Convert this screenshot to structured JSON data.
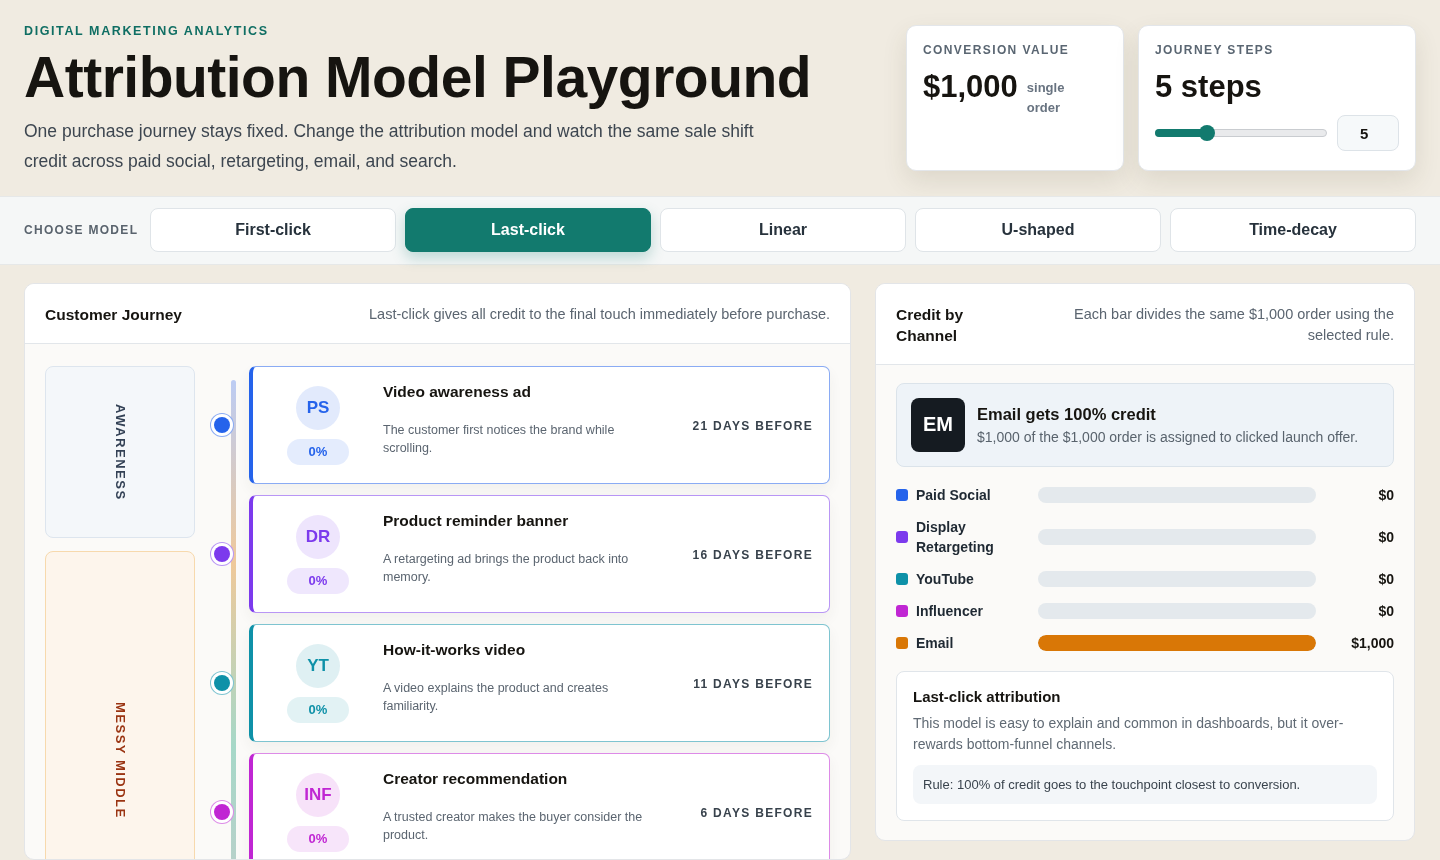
{
  "header": {
    "eyebrow": "DIGITAL MARKETING ANALYTICS",
    "title": "Attribution Model Playground",
    "subtitle": "One purchase journey stays fixed. Change the attribution model and watch the same sale shift credit across paid social, retargeting, email, and search."
  },
  "conversion": {
    "label": "CONVERSION VALUE",
    "value": "$1,000",
    "note": "single order"
  },
  "journey_steps": {
    "label": "JOURNEY STEPS",
    "value": "5 steps",
    "level": 0.3,
    "input": "5"
  },
  "model_bar": {
    "label": "CHOOSE MODEL",
    "tabs": [
      {
        "label": "First-click",
        "selected": false
      },
      {
        "label": "Last-click",
        "selected": true
      },
      {
        "label": "Linear",
        "selected": false
      },
      {
        "label": "U-shaped",
        "selected": false
      },
      {
        "label": "Time-decay",
        "selected": false
      }
    ]
  },
  "journey": {
    "title": "Customer Journey",
    "description": "Last-click gives all credit to the final touch immediately before purchase.",
    "stages": [
      {
        "label": "AWARENESS",
        "kind": "neutral"
      },
      {
        "label": "MESSY MIDDLE",
        "kind": "warm"
      }
    ],
    "steps": [
      {
        "initials": "PS",
        "share": "0%",
        "title": "Video awareness ad",
        "description": "The customer first notices the brand while scrolling.",
        "timing": "21 DAYS BEFORE",
        "color": "#2563eb"
      },
      {
        "initials": "DR",
        "share": "0%",
        "title": "Product reminder banner",
        "description": "A retargeting ad brings the product back into memory.",
        "timing": "16 DAYS BEFORE",
        "color": "#7c3aed"
      },
      {
        "initials": "YT",
        "share": "0%",
        "title": "How-it-works video",
        "description": "A video explains the product and creates familiarity.",
        "timing": "11 DAYS BEFORE",
        "color": "#0e91a8"
      },
      {
        "initials": "INF",
        "share": "0%",
        "title": "Creator recommendation",
        "description": "A trusted creator makes the buyer consider the product.",
        "timing": "6 DAYS BEFORE",
        "color": "#c026d3"
      }
    ]
  },
  "credit": {
    "title": "Credit by Channel",
    "description": "Each bar divides the same $1,000 order using the selected rule.",
    "highlight": {
      "initials": "EM",
      "title": "Email gets 100% credit",
      "description": "$1,000 of the $1,000 order is assigned to clicked launch offer."
    },
    "channels": [
      {
        "name": "Paid Social",
        "color": "#2563eb",
        "level": 0,
        "reading": "$0"
      },
      {
        "name": "Display Retargeting",
        "color": "#7c3aed",
        "level": 0,
        "reading": "$0"
      },
      {
        "name": "YouTube",
        "color": "#0e91a8",
        "level": 0,
        "reading": "$0"
      },
      {
        "name": "Influencer",
        "color": "#c026d3",
        "level": 0,
        "reading": "$0"
      },
      {
        "name": "Email",
        "color": "#d97706",
        "level": 1,
        "reading": "$1,000"
      }
    ],
    "explanation": {
      "title": "Last-click attribution",
      "body": "This model is easy to explain and common in dashboards, but it over-rewards bottom-funnel channels.",
      "rule": "Rule: 100% of credit goes to the touchpoint closest to conversion."
    }
  }
}
